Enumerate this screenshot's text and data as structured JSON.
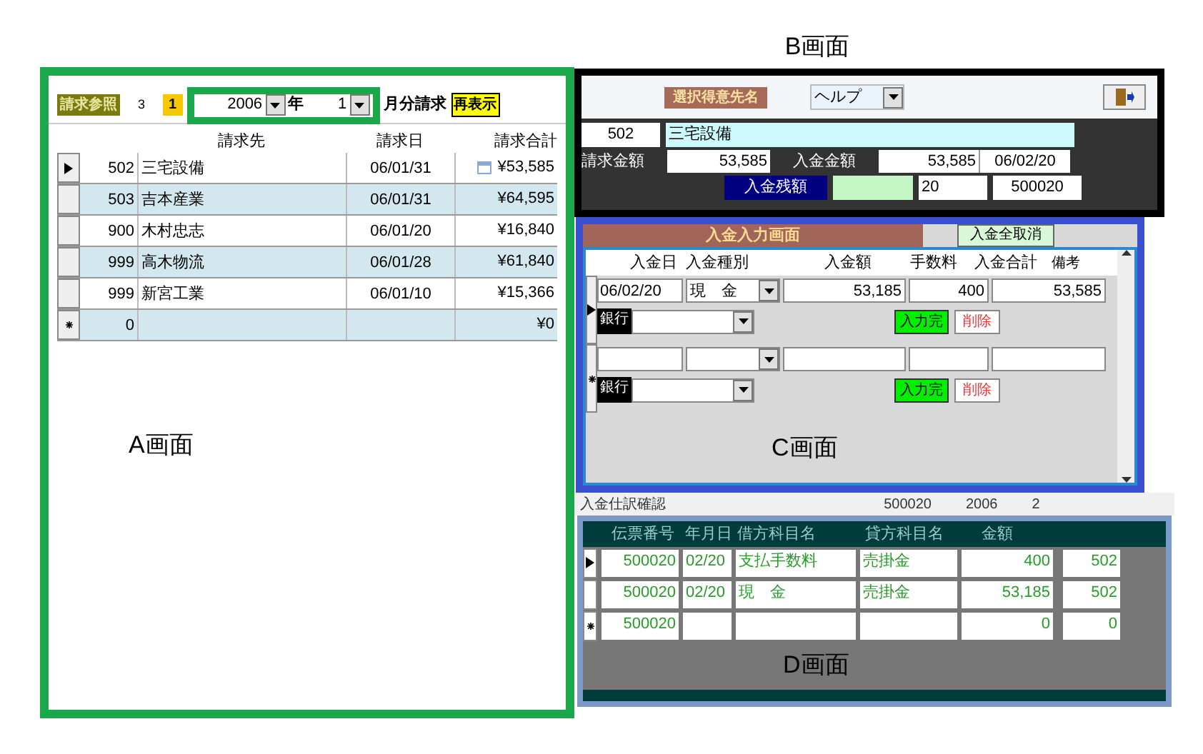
{
  "screen_a": {
    "label": "A画面",
    "toolbar": {
      "title": "請求参照",
      "count": "3",
      "badge": "1",
      "year": "2006",
      "year_unit": "年",
      "month": "1",
      "month_suffix": "月分請求",
      "refresh": "再表示"
    },
    "columns": [
      "請求先",
      "請求日",
      "請求合計"
    ],
    "rows": [
      {
        "kind": "current",
        "code": "502",
        "name": "三宅設備",
        "date": "06/01/31",
        "total": "¥53,585"
      },
      {
        "kind": "normal",
        "code": "503",
        "name": "吉本産業",
        "date": "06/01/31",
        "total": "¥64,595"
      },
      {
        "kind": "normal",
        "code": "900",
        "name": "木村忠志",
        "date": "06/01/20",
        "total": "¥16,840"
      },
      {
        "kind": "normal",
        "code": "999",
        "name": "高木物流",
        "date": "06/01/28",
        "total": "¥61,840"
      },
      {
        "kind": "normal",
        "code": "999",
        "name": "新宮工業",
        "date": "06/01/10",
        "total": "¥15,366"
      },
      {
        "kind": "new",
        "code": "0",
        "total": "¥0"
      }
    ]
  },
  "screen_b": {
    "label": "B画面",
    "title": "選択得意先名",
    "help": "ヘルプ",
    "code": "502",
    "name": "三宅設備",
    "billed_label": "請求金額",
    "billed": "53,585",
    "paid_label": "入金金額",
    "paid": "53,585",
    "date": "06/02/20",
    "balance_label": "入金残額",
    "day": "20",
    "slip": "500020"
  },
  "screen_c": {
    "label": "C画面",
    "title": "入金入力画面",
    "cancel_all": "入金全取消",
    "columns": [
      "入金日",
      "入金種別",
      "入金額",
      "手数料",
      "入金合計",
      "備考"
    ],
    "records": [
      {
        "kind": "current",
        "date": "06/02/20",
        "type": "現　金",
        "amount": "53,185",
        "fee": "400",
        "total": "53,585",
        "bank_label": "銀行",
        "confirm": "入力完",
        "delete": "削除"
      },
      {
        "kind": "new",
        "bank_label": "銀行",
        "confirm": "入力完",
        "delete": "削除"
      }
    ]
  },
  "journal_check": {
    "label": "入金仕訳確認",
    "slip": "500020",
    "year": "2006",
    "month": "2"
  },
  "screen_d": {
    "label": "D画面",
    "columns": [
      "伝票番号",
      "年月日",
      "借方科目名",
      "貸方科目名",
      "金額"
    ],
    "rows": [
      {
        "kind": "current",
        "cells": [
          "500020",
          "02/20",
          "支払手数料",
          "売掛金",
          "400",
          "502"
        ]
      },
      {
        "kind": "normal",
        "cells": [
          "500020",
          "02/20",
          "現　金",
          "売掛金",
          "53,185",
          "502"
        ]
      },
      {
        "kind": "new",
        "cells": [
          "500020",
          null,
          null,
          null,
          "0",
          "0"
        ]
      }
    ]
  }
}
